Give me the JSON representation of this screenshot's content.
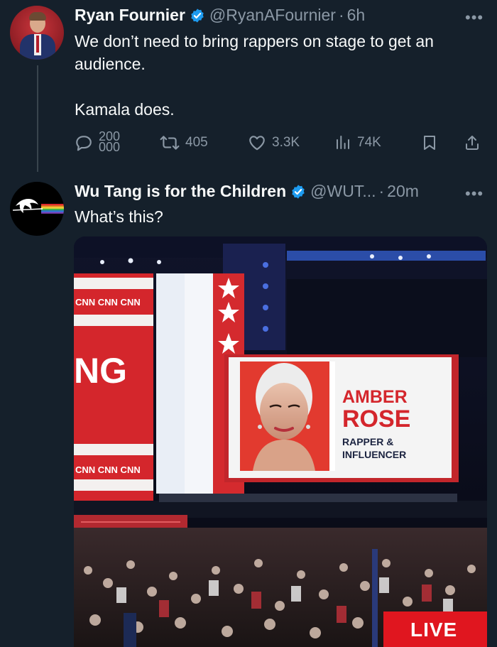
{
  "tweet1": {
    "display_name": "Ryan Fournier",
    "handle": "@RyanAFournier",
    "separator": "·",
    "time": "6h",
    "text_line1": "We don’t need to bring rappers on stage to get an",
    "text_line2": "audience.",
    "text_line3": "Kamala does.",
    "replies_top": "200",
    "replies_bottom": "000",
    "reposts": "405",
    "likes": "3.3K",
    "views": "74K",
    "more": "•••"
  },
  "tweet2": {
    "display_name": "Wu Tang is for the Children",
    "handle": "@WUT...",
    "separator": "·",
    "time": "20m",
    "text": "What’s this?",
    "more": "•••"
  },
  "media": {
    "lower_third_name_line1": "AMBER",
    "lower_third_name_line2": "ROSE",
    "lower_third_title_line1": "RAPPER &",
    "lower_third_title_line2": "INFLUENCER",
    "ticker_text": "CNN CNN CNN",
    "ticker_text_bottom": "CNN CNN CNN",
    "partial_screen_text": "NG",
    "live_badge": "LIVE"
  },
  "colors": {
    "background": "#15202b",
    "verified_blue": "#1d9bf0",
    "secondary_text": "#8b98a5",
    "live_red": "#e0161f"
  },
  "icons": {
    "reply": "reply-icon",
    "repost": "repost-icon",
    "like": "heart-icon",
    "views": "views-icon",
    "bookmark": "bookmark-icon",
    "share": "share-icon",
    "verified": "verified-badge-icon"
  }
}
